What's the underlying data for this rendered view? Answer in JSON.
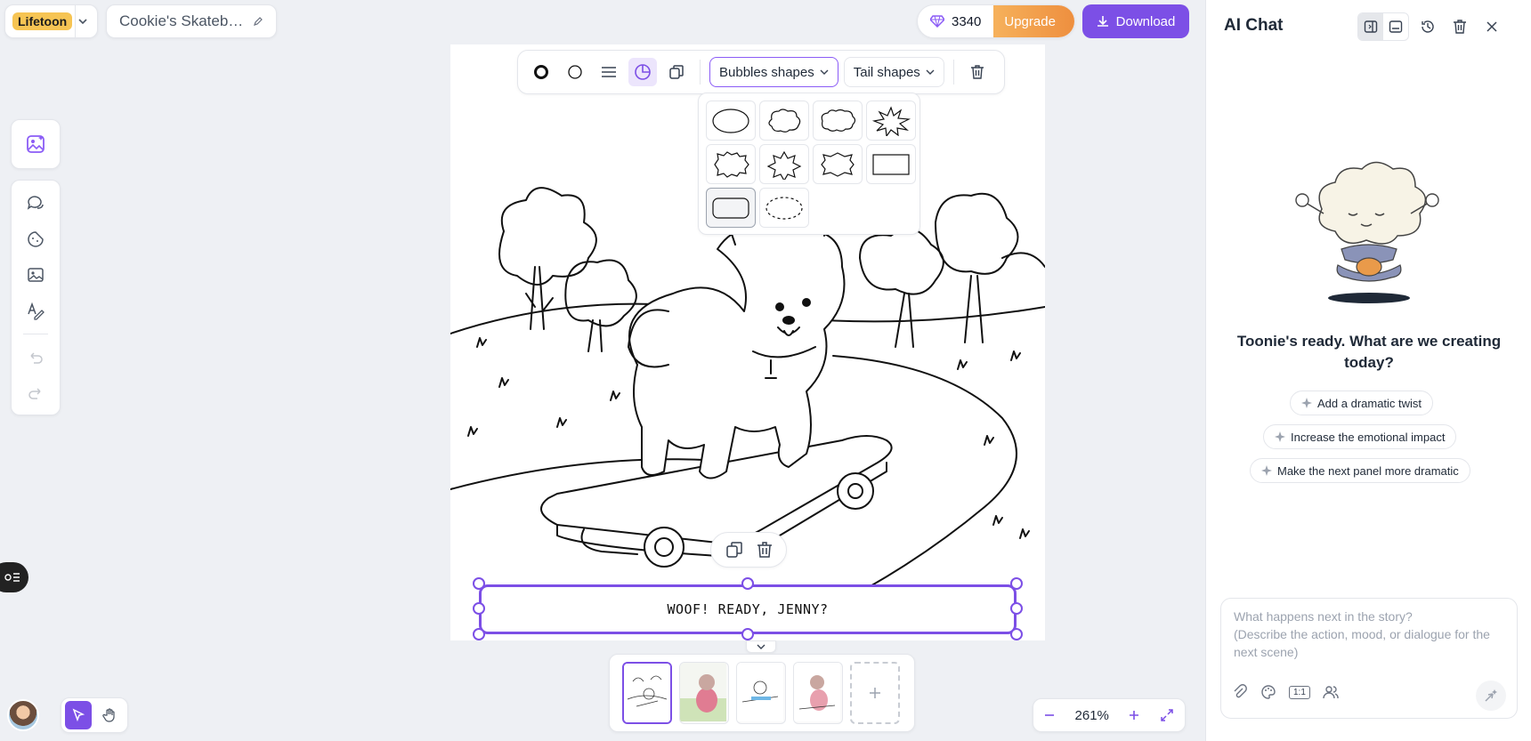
{
  "brand": {
    "logo": "Lifetoon"
  },
  "project": {
    "title": "Cookie's Skateb…"
  },
  "credits": {
    "count": "3340",
    "upgrade_label": "Upgrade"
  },
  "download_label": "Download",
  "format_toolbar": {
    "bubble_shapes_label": "Bubbles shapes",
    "tail_shapes_label": "Tail shapes"
  },
  "bubble_shapes": [
    "ellipse",
    "cloud",
    "cloud-wide",
    "starburst",
    "jagged",
    "spiky",
    "wavy",
    "rectangle",
    "rounded-rectangle",
    "dashed-ellipse"
  ],
  "selected_bubble_shape": "rounded-rectangle",
  "caption": {
    "text": "WOOF! READY, JENNY?"
  },
  "pages": {
    "count": 4,
    "active": 1
  },
  "zoom": {
    "level": "261%"
  },
  "chat": {
    "title": "AI Chat",
    "ready_text": "Toonie's ready. What are we creating today?",
    "suggestions": [
      "Add a dramatic twist",
      "Increase the emotional impact",
      "Make the next panel more dramatic"
    ],
    "input_placeholder": "What happens next in the story?\n(Describe the action, mood, or dialogue for the next scene)",
    "ratio_label": "1:1"
  },
  "colors": {
    "accent": "#7c4fe6",
    "upgrade": "#f0a04b",
    "canvas": "#ffffff",
    "background": "#eef0f4"
  },
  "icons": [
    "diamond-icon",
    "download-icon",
    "ai-image-icon",
    "speech-bubble-icon",
    "sticker-icon",
    "image-icon",
    "text-draw-icon",
    "undo-icon",
    "redo-icon",
    "cursor-icon",
    "hand-icon",
    "trash-icon",
    "duplicate-icon",
    "history-icon",
    "close-icon",
    "attach-icon",
    "palette-icon",
    "characters-icon",
    "send-icon"
  ]
}
